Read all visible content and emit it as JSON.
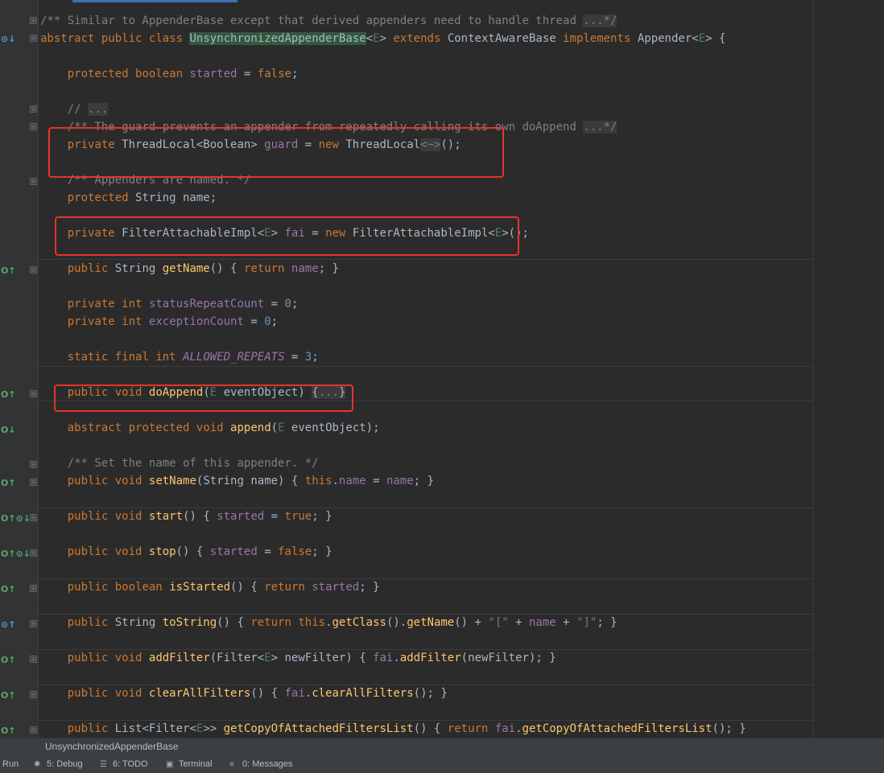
{
  "editor": {
    "class_name": "UnsynchronizedAppenderBase"
  },
  "status_bar": {
    "file_tab": "UnsynchronizedAppenderBase",
    "tool_windows": [
      {
        "name": "run",
        "label": "Run",
        "icon": "run-icon"
      },
      {
        "name": "debug",
        "label": "5: Debug",
        "icon": "bug-icon"
      },
      {
        "name": "todo",
        "label": "6: TODO",
        "icon": "list-icon"
      },
      {
        "name": "terminal",
        "label": "Terminal",
        "icon": "terminal-icon"
      },
      {
        "name": "messages",
        "label": "0: Messages",
        "icon": "messages-icon"
      }
    ]
  },
  "code_lines": [
    "/** Similar to AppenderBase except that derived appenders need to handle thread ...*/",
    "abstract public class UnsynchronizedAppenderBase<E> extends ContextAwareBase implements Appender<E> {",
    "",
    "    protected boolean started = false;",
    "",
    "    // ...",
    "    /** The guard prevents an appender from repeatedly calling its own doAppend ...*/",
    "    private ThreadLocal<Boolean> guard = new ThreadLocal<~>();",
    "",
    "    /** Appenders are named. */",
    "    protected String name;",
    "",
    "    private FilterAttachableImpl<E> fai = new FilterAttachableImpl<E>();",
    "",
    "    public String getName() { return name; }",
    "",
    "    private int statusRepeatCount = 0;",
    "    private int exceptionCount = 0;",
    "",
    "    static final int ALLOWED_REPEATS = 3;",
    "",
    "    public void doAppend(E eventObject) {...}",
    "",
    "    abstract protected void append(E eventObject);",
    "",
    "    /** Set the name of this appender. */",
    "    public void setName(String name) { this.name = name; }",
    "",
    "    public void start() { started = true; }",
    "",
    "    public void stop() { started = false; }",
    "",
    "    public boolean isStarted() { return started; }",
    "",
    "    public String toString() { return this.getClass().getName() + \"[\" + name + \"]\"; }",
    "",
    "    public void addFilter(Filter<E> newFilter) { fai.addFilter(newFilter); }",
    "",
    "    public void clearAllFilters() { fai.clearAllFilters(); }",
    "",
    "    public List<Filter<E>> getCopyOfAttachedFiltersList() { return fai.getCopyOfAttachedFiltersList(); }"
  ]
}
